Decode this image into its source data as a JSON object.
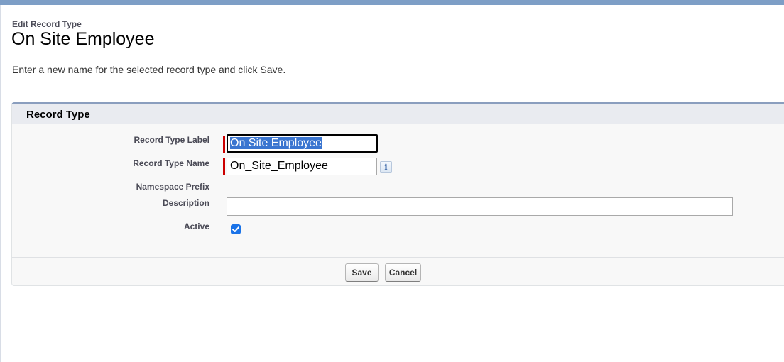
{
  "header": {
    "breadcrumb": "Edit Record Type",
    "title": "On Site Employee",
    "instructions": "Enter a new name for the selected record type and click Save."
  },
  "section": {
    "title": "Record Type"
  },
  "fields": {
    "label": {
      "label": "Record Type Label",
      "value": "On Site Employee"
    },
    "name": {
      "label": "Record Type Name",
      "value": "On_Site_Employee"
    },
    "namespace": {
      "label": "Namespace Prefix",
      "value": ""
    },
    "description": {
      "label": "Description",
      "value": ""
    },
    "active": {
      "label": "Active",
      "checked": true
    }
  },
  "buttons": {
    "save": "Save",
    "cancel": "Cancel"
  },
  "icons": {
    "info": "i"
  },
  "colors": {
    "banner": "#7d9ec6",
    "required": "#cc0000",
    "selection": "#3a75d0",
    "checkbox": "#1a73e8"
  }
}
